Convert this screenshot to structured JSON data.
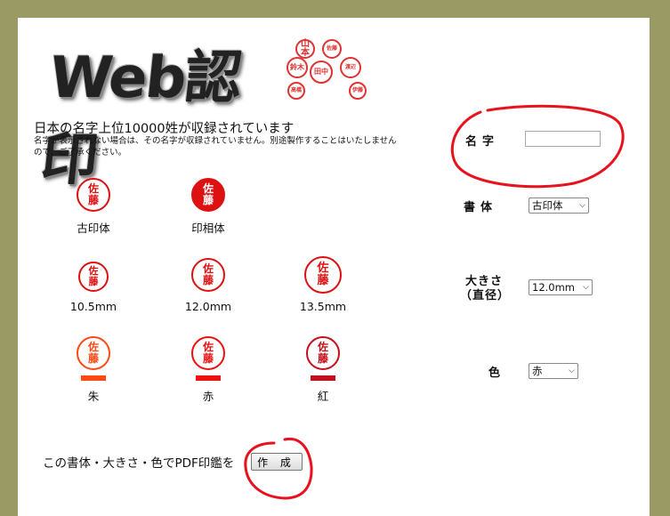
{
  "logo": {
    "text": "Web認印",
    "mini_seals": [
      "山本",
      "鈴木",
      "田中",
      "高橋",
      "佐藤",
      "渡辺",
      "伊藤"
    ]
  },
  "intro": {
    "headline": "日本の名字上位10000姓が収録されています",
    "note": "名字が表示されない場合は、その名字が収録されていません。別途製作することはいたしませんので、ご了承ください。"
  },
  "preview_name": [
    "佐",
    "藤"
  ],
  "styles": [
    {
      "label": "古印体",
      "color": "#dd1111",
      "solid": false
    },
    {
      "label": "印相体",
      "color": "#dd1111",
      "solid": true
    }
  ],
  "sizes": [
    {
      "label": "10.5mm"
    },
    {
      "label": "12.0mm"
    },
    {
      "label": "13.5mm"
    }
  ],
  "colors": [
    {
      "label": "朱",
      "hex": "#ff4a14"
    },
    {
      "label": "赤",
      "hex": "#ee1111"
    },
    {
      "label": "紅",
      "hex": "#c4101a"
    }
  ],
  "form": {
    "name_label": "名字",
    "name_value": "",
    "style_label": "書体",
    "style_value": "古印体",
    "size_label_1": "大きさ",
    "size_label_2": "（直径）",
    "size_value": "12.0mm",
    "color_label": "色",
    "color_value": "赤"
  },
  "footer": {
    "create_text": "この書体・大きさ・色でPDF印鑑を",
    "create_button": "作 成"
  },
  "theme": {
    "frame": "#9a9a64",
    "annotation_red": "#e8121e"
  }
}
